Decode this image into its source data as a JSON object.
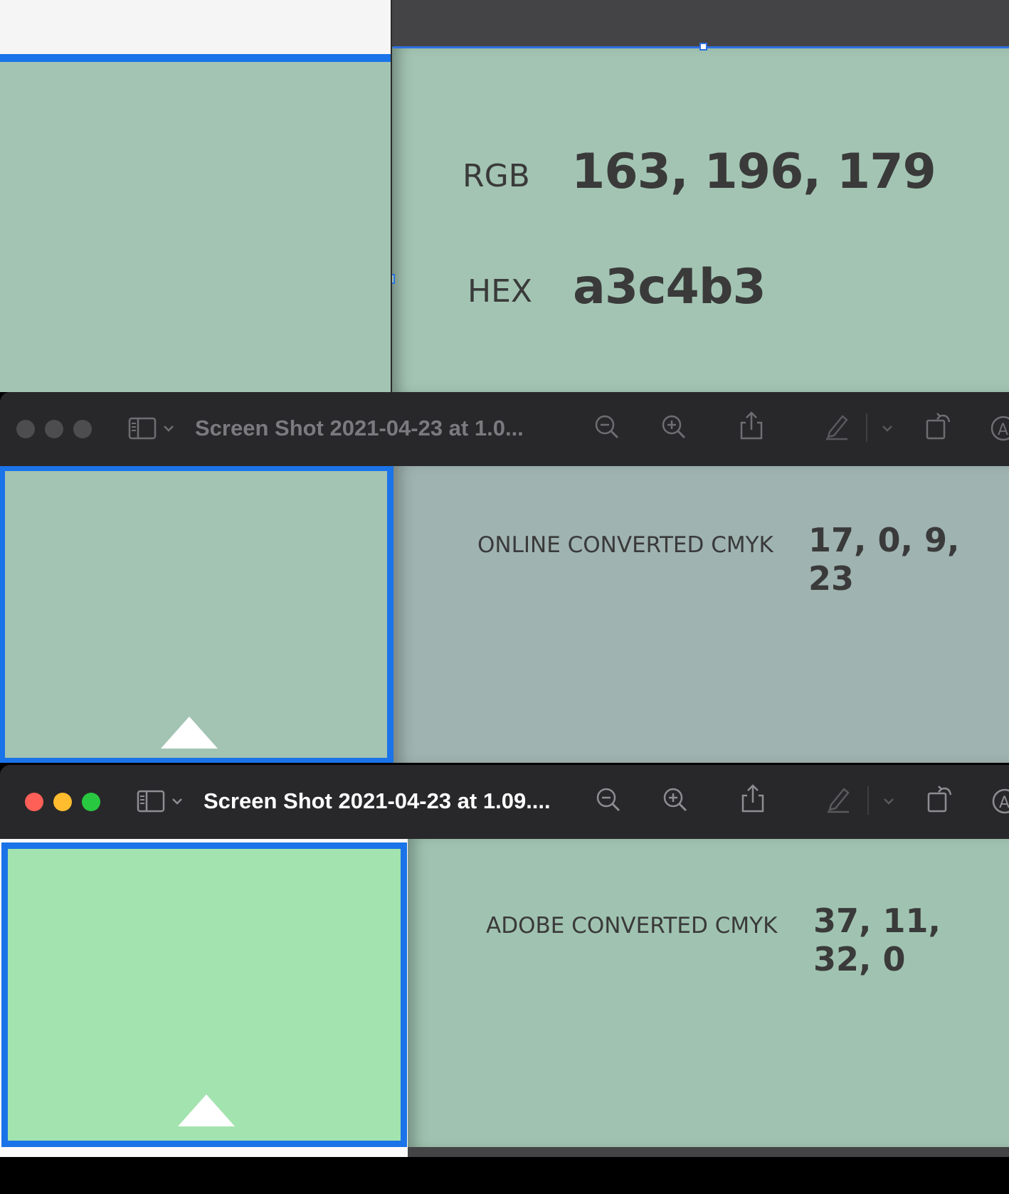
{
  "top_window": {
    "rgb_label": "RGB",
    "rgb_value": "163, 196, 179",
    "hex_label": "HEX",
    "hex_value": "a3c4b3",
    "swatch_color": "#a3c4b3"
  },
  "middle_window": {
    "title": "Screen Shot 2021-04-23 at 1.0...",
    "active": false,
    "cmyk_label": "ONLINE CONVERTED CMYK",
    "cmyk_value": "17, 0, 9, 23",
    "swatch_color": "#a3c4b3"
  },
  "bottom_window": {
    "title": "Screen Shot 2021-04-23 at 1.09....",
    "active": true,
    "cmyk_label": "ADOBE CONVERTED CMYK",
    "cmyk_value": "37, 11, 32, 0",
    "swatch_color": "#a3e3af"
  },
  "toolbar_icons": [
    "sidebar-icon",
    "chevron-down-icon",
    "zoom-out-icon",
    "zoom-in-icon",
    "share-icon",
    "markup-pen-icon",
    "chevron-down-icon",
    "rotate-icon",
    "annotate-icon"
  ],
  "colors": {
    "selection_blue": "#1a73e8",
    "close_red": "#fe5f57",
    "minimize_yellow": "#febc2e",
    "zoom_green": "#28c840",
    "inactive_light": "#4d4d4f"
  }
}
